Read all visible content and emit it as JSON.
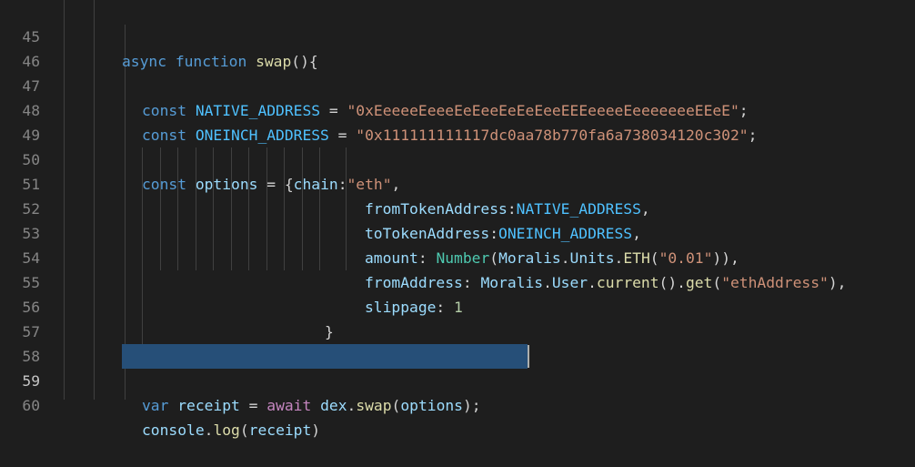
{
  "colors": {
    "background": "#1e1e1e",
    "line_number": "#858585",
    "keyword": "#569cd6",
    "function": "#dcdcaa",
    "constant": "#4fc1ff",
    "variable": "#9cdcfe",
    "string": "#ce9178",
    "number": "#b5cea8",
    "selection": "#264f78"
  },
  "editor": {
    "active_line": "59",
    "lines": [
      {
        "n": "45",
        "tokens": [
          "async ",
          "function ",
          "swap",
          "(){"
        ]
      },
      {
        "n": "46",
        "tokens": []
      },
      {
        "n": "47",
        "tokens": [
          "const ",
          "NATIVE_ADDRESS",
          " = ",
          "\"0xEeeeeEeeeEeEeeEeEeEeeEEEeeeeEeeeeeeeEEeE\"",
          ";"
        ]
      },
      {
        "n": "48",
        "tokens": [
          "const ",
          "ONEINCH_ADDRESS",
          " = ",
          "\"0x111111111117dc0aa78b770fa6a738034120c302\"",
          ";"
        ]
      },
      {
        "n": "49",
        "tokens": []
      },
      {
        "n": "50",
        "tokens": [
          "const ",
          "options",
          " = {",
          "chain",
          ":",
          "\"eth\"",
          ","
        ]
      },
      {
        "n": "51",
        "tokens": [
          "fromTokenAddress",
          ":",
          "NATIVE_ADDRESS",
          ","
        ]
      },
      {
        "n": "52",
        "tokens": [
          "toTokenAddress",
          ":",
          "ONEINCH_ADDRESS",
          ","
        ]
      },
      {
        "n": "53",
        "tokens": [
          "amount",
          ": ",
          "Number",
          "(",
          "Moralis",
          ".",
          "Units",
          ".",
          "ETH",
          "(",
          "\"0.01\"",
          "))",
          ","
        ]
      },
      {
        "n": "54",
        "tokens": [
          "fromAddress",
          ": ",
          "Moralis",
          ".",
          "User",
          ".",
          "current",
          "().",
          "get",
          "(",
          "\"ethAddress\"",
          "),"
        ]
      },
      {
        "n": "55",
        "tokens": [
          "slippage",
          ": ",
          "1"
        ]
      },
      {
        "n": "56",
        "tokens": [
          "}"
        ]
      },
      {
        "n": "57",
        "tokens": []
      },
      {
        "n": "58",
        "tokens": []
      },
      {
        "n": "59",
        "tokens": [
          "var ",
          "receipt",
          " = ",
          "await ",
          "dex",
          ".",
          "swap",
          "(",
          "options",
          ");"
        ]
      },
      {
        "n": "60",
        "tokens": [
          "console",
          ".",
          "log",
          "(",
          "receipt",
          ")"
        ]
      }
    ]
  }
}
